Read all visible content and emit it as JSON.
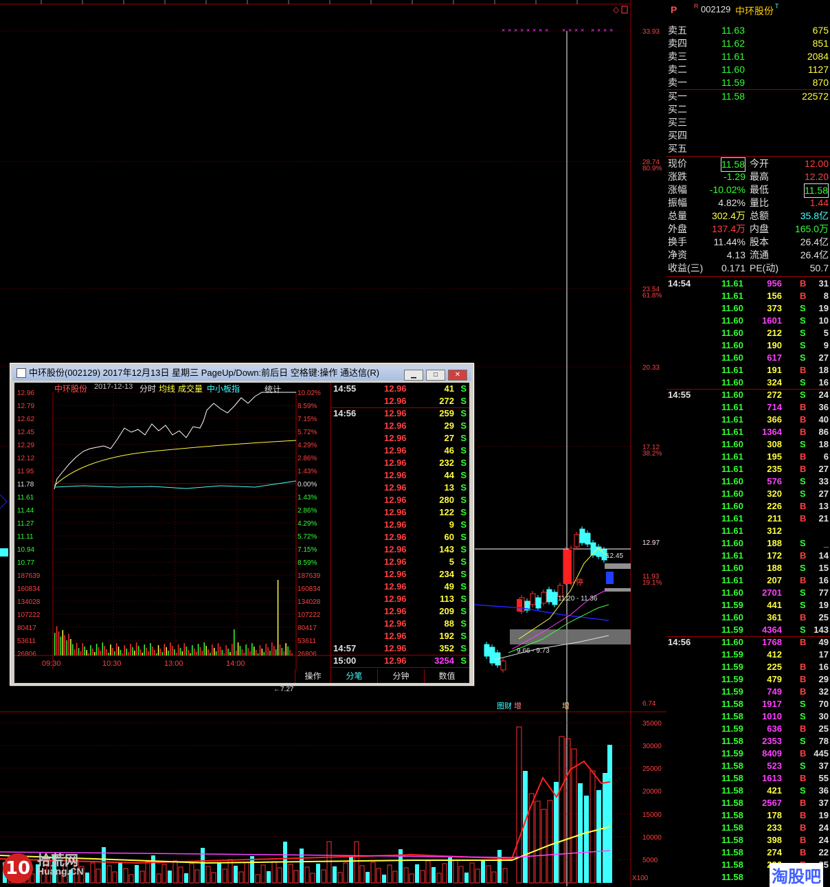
{
  "main_chart": {
    "price_axis": [
      {
        "label": "33.93",
        "pct": ""
      },
      {
        "label": "28.74",
        "pct": "80.9%"
      },
      {
        "label": "23.54",
        "pct": "61.8%"
      },
      {
        "label": "20.33",
        "pct": ""
      },
      {
        "label": "17.12",
        "pct": "38.2%"
      },
      {
        "label": "12.97",
        "pct": ""
      },
      {
        "label": "11.93",
        "pct": "19.1%"
      },
      {
        "label": "6.74",
        "pct": ""
      }
    ],
    "volume_axis": [
      "35000",
      "30000",
      "25000",
      "20000",
      "15000",
      "10000",
      "5000",
      "X100"
    ],
    "annotations": {
      "high_mark": "12.45",
      "mid_range": "11.20 - 11.36",
      "low_range": "9.66 - 9.73",
      "left_arrow": "←7.27",
      "event_tags": [
        "增",
        "增",
        "增"
      ],
      "event_tag_label": "图财",
      "stop_tag": "停"
    },
    "colors": {
      "up": "#ff3030",
      "down": "#40ffff",
      "grid": "#800000"
    }
  },
  "quote_panel": {
    "flag": "P",
    "r_flag": "R",
    "code": "002129",
    "name": "中环股份",
    "t_flag": "T",
    "sells": [
      {
        "label": "卖五",
        "price": "11.63",
        "vol": "675"
      },
      {
        "label": "卖四",
        "price": "11.62",
        "vol": "851"
      },
      {
        "label": "卖三",
        "price": "11.61",
        "vol": "2084"
      },
      {
        "label": "卖二",
        "price": "11.60",
        "vol": "1127"
      },
      {
        "label": "卖一",
        "price": "11.59",
        "vol": "870"
      }
    ],
    "buys": [
      {
        "label": "买一",
        "price": "11.58",
        "vol": "22572"
      },
      {
        "label": "买二",
        "price": "",
        "vol": ""
      },
      {
        "label": "买三",
        "price": "",
        "vol": ""
      },
      {
        "label": "买四",
        "price": "",
        "vol": ""
      },
      {
        "label": "买五",
        "price": "",
        "vol": ""
      }
    ],
    "stats": [
      {
        "l1": "现价",
        "v1": "11.58",
        "l2": "今开",
        "v2": "12.00"
      },
      {
        "l1": "涨跌",
        "v1": "-1.29",
        "l2": "最高",
        "v2": "12.20"
      },
      {
        "l1": "涨幅",
        "v1": "-10.02%",
        "l2": "最低",
        "v2": "11.58"
      },
      {
        "l1": "振幅",
        "v1": "4.82%",
        "l2": "量比",
        "v2": "1.44"
      },
      {
        "l1": "总量",
        "v1": "302.4万",
        "l2": "总额",
        "v2": "35.8亿"
      },
      {
        "l1": "外盘",
        "v1": "137.4万",
        "l2": "内盘",
        "v2": "165.0万"
      },
      {
        "l1": "换手",
        "v1": "11.44%",
        "l2": "股本",
        "v2": "26.4亿"
      },
      {
        "l1": "净资",
        "v1": "4.13",
        "l2": "流通",
        "v2": "26.4亿"
      },
      {
        "l1": "收益(三)",
        "v1": "0.171",
        "l2": "PE(动)",
        "v2": "50.7"
      }
    ],
    "trades": [
      {
        "t": "14:54",
        "p": "11.61",
        "v": "956",
        "s": "B",
        "n": "31"
      },
      {
        "t": "",
        "p": "11.61",
        "v": "156",
        "s": "B",
        "n": "8"
      },
      {
        "t": "",
        "p": "11.60",
        "v": "373",
        "s": "S",
        "n": "19"
      },
      {
        "t": "",
        "p": "11.60",
        "v": "1601",
        "s": "S",
        "n": "10"
      },
      {
        "t": "",
        "p": "11.60",
        "v": "212",
        "s": "S",
        "n": "5"
      },
      {
        "t": "",
        "p": "11.60",
        "v": "190",
        "s": "S",
        "n": "9"
      },
      {
        "t": "",
        "p": "11.60",
        "v": "617",
        "s": "S",
        "n": "27"
      },
      {
        "t": "",
        "p": "11.61",
        "v": "191",
        "s": "B",
        "n": "18"
      },
      {
        "t": "",
        "p": "11.60",
        "v": "324",
        "s": "S",
        "n": "16"
      },
      {
        "t": "14:55",
        "p": "11.60",
        "v": "272",
        "s": "S",
        "n": "24"
      },
      {
        "t": "",
        "p": "11.61",
        "v": "714",
        "s": "B",
        "n": "36"
      },
      {
        "t": "",
        "p": "11.61",
        "v": "366",
        "s": "B",
        "n": "40"
      },
      {
        "t": "",
        "p": "11.61",
        "v": "1364",
        "s": "B",
        "n": "86"
      },
      {
        "t": "",
        "p": "11.60",
        "v": "308",
        "s": "S",
        "n": "18"
      },
      {
        "t": "",
        "p": "11.61",
        "v": "195",
        "s": "B",
        "n": "6"
      },
      {
        "t": "",
        "p": "11.61",
        "v": "235",
        "s": "B",
        "n": "27"
      },
      {
        "t": "",
        "p": "11.60",
        "v": "576",
        "s": "S",
        "n": "33"
      },
      {
        "t": "",
        "p": "11.60",
        "v": "320",
        "s": "S",
        "n": "27"
      },
      {
        "t": "",
        "p": "11.60",
        "v": "226",
        "s": "B",
        "n": "13"
      },
      {
        "t": "",
        "p": "11.61",
        "v": "211",
        "s": "B",
        "n": "21"
      },
      {
        "t": "",
        "p": "11.61",
        "v": "312",
        "s": "",
        "n": ""
      },
      {
        "t": "",
        "p": "11.60",
        "v": "188",
        "s": "S",
        "n": "_"
      },
      {
        "t": "",
        "p": "11.61",
        "v": "172",
        "s": "B",
        "n": "14"
      },
      {
        "t": "",
        "p": "11.60",
        "v": "188",
        "s": "S",
        "n": "15"
      },
      {
        "t": "",
        "p": "11.61",
        "v": "207",
        "s": "B",
        "n": "16"
      },
      {
        "t": "",
        "p": "11.60",
        "v": "2701",
        "s": "S",
        "n": "77"
      },
      {
        "t": "",
        "p": "11.59",
        "v": "441",
        "s": "S",
        "n": "19"
      },
      {
        "t": "",
        "p": "11.60",
        "v": "361",
        "s": "B",
        "n": "25"
      },
      {
        "t": "",
        "p": "11.59",
        "v": "4364",
        "s": "S",
        "n": "143"
      },
      {
        "t": "14:56",
        "p": "11.60",
        "v": "1768",
        "s": "B",
        "n": "49"
      },
      {
        "t": "",
        "p": "11.59",
        "v": "412",
        "s": "",
        "n": "17"
      },
      {
        "t": "",
        "p": "11.59",
        "v": "225",
        "s": "B",
        "n": "16"
      },
      {
        "t": "",
        "p": "11.59",
        "v": "479",
        "s": "B",
        "n": "29"
      },
      {
        "t": "",
        "p": "11.59",
        "v": "749",
        "s": "B",
        "n": "32"
      },
      {
        "t": "",
        "p": "11.58",
        "v": "1917",
        "s": "S",
        "n": "70"
      },
      {
        "t": "",
        "p": "11.58",
        "v": "1010",
        "s": "S",
        "n": "30"
      },
      {
        "t": "",
        "p": "11.59",
        "v": "636",
        "s": "B",
        "n": "25"
      },
      {
        "t": "",
        "p": "11.58",
        "v": "2353",
        "s": "S",
        "n": "78"
      },
      {
        "t": "",
        "p": "11.59",
        "v": "8409",
        "s": "B",
        "n": "445"
      },
      {
        "t": "",
        "p": "11.58",
        "v": "523",
        "s": "S",
        "n": "37"
      },
      {
        "t": "",
        "p": "11.58",
        "v": "1613",
        "s": "B",
        "n": "55"
      },
      {
        "t": "",
        "p": "11.58",
        "v": "421",
        "s": "S",
        "n": "36"
      },
      {
        "t": "",
        "p": "11.58",
        "v": "2567",
        "s": "B",
        "n": "37"
      },
      {
        "t": "",
        "p": "11.58",
        "v": "178",
        "s": "B",
        "n": "19"
      },
      {
        "t": "",
        "p": "11.58",
        "v": "233",
        "s": "B",
        "n": "24"
      },
      {
        "t": "",
        "p": "11.58",
        "v": "398",
        "s": "B",
        "n": "24"
      },
      {
        "t": "",
        "p": "11.58",
        "v": "274",
        "s": "B",
        "n": "22"
      },
      {
        "t": "",
        "p": "11.58",
        "v": "296",
        "s": "B",
        "n": "25"
      },
      {
        "t": "",
        "p": "11.58",
        "v": "",
        "s": "",
        "n": ""
      }
    ]
  },
  "popup": {
    "title": "中环股份(002129) 2017年12月13日 星期三 PageUp/Down:前后日 空格键:操作 通达信(R)",
    "chart_header": {
      "name": "中环股份",
      "date": "2017-12-13",
      "mode": "分时",
      "avg": "均线",
      "vol": "成交量",
      "index": "中小板指",
      "stat": "统计"
    },
    "price_ticks": [
      "12.96",
      "12.79",
      "12.62",
      "12.45",
      "12.29",
      "12.12",
      "11.95",
      "11.78",
      "11.61",
      "11.44",
      "11.27",
      "11.11",
      "10.94",
      "10.77"
    ],
    "pct_ticks": [
      "10.02%",
      "8.59%",
      "7.15%",
      "5.72%",
      "4.29%",
      "2.86%",
      "1.43%",
      "0.00%",
      "1.43%",
      "2.86%",
      "4.29%",
      "5.72%",
      "7.15%",
      "8.59%"
    ],
    "vol_ticks": [
      "187639",
      "160834",
      "134028",
      "107222",
      "80417",
      "53611",
      "26806"
    ],
    "time_ticks": [
      "09:30",
      "10:30",
      "13:00",
      "14:00"
    ],
    "trades": [
      {
        "t": "14:55",
        "p": "12.96",
        "v": "41",
        "s": "S"
      },
      {
        "t": "",
        "p": "12.96",
        "v": "272",
        "s": "S"
      },
      {
        "t": "14:56",
        "p": "12.96",
        "v": "259",
        "s": "S"
      },
      {
        "t": "",
        "p": "12.96",
        "v": "29",
        "s": "S"
      },
      {
        "t": "",
        "p": "12.96",
        "v": "27",
        "s": "S"
      },
      {
        "t": "",
        "p": "12.96",
        "v": "46",
        "s": "S"
      },
      {
        "t": "",
        "p": "12.96",
        "v": "232",
        "s": "S"
      },
      {
        "t": "",
        "p": "12.96",
        "v": "44",
        "s": "S"
      },
      {
        "t": "",
        "p": "12.96",
        "v": "13",
        "s": "S"
      },
      {
        "t": "",
        "p": "12.96",
        "v": "280",
        "s": "S"
      },
      {
        "t": "",
        "p": "12.96",
        "v": "122",
        "s": "S"
      },
      {
        "t": "",
        "p": "12.96",
        "v": "9",
        "s": "S"
      },
      {
        "t": "",
        "p": "12.96",
        "v": "60",
        "s": "S"
      },
      {
        "t": "",
        "p": "12.96",
        "v": "143",
        "s": "S"
      },
      {
        "t": "",
        "p": "12.96",
        "v": "5",
        "s": "S"
      },
      {
        "t": "",
        "p": "12.96",
        "v": "234",
        "s": "S"
      },
      {
        "t": "",
        "p": "12.96",
        "v": "49",
        "s": "S"
      },
      {
        "t": "",
        "p": "12.96",
        "v": "113",
        "s": "S"
      },
      {
        "t": "",
        "p": "12.96",
        "v": "209",
        "s": "S"
      },
      {
        "t": "",
        "p": "12.96",
        "v": "88",
        "s": "S"
      },
      {
        "t": "",
        "p": "12.96",
        "v": "192",
        "s": "S"
      },
      {
        "t": "14:57",
        "p": "12.96",
        "v": "352",
        "s": "S"
      },
      {
        "t": "15:00",
        "p": "12.96",
        "v": "3254",
        "s": "S"
      }
    ],
    "tabs": [
      "操作",
      "分笔",
      "分钟",
      "数值"
    ]
  },
  "watermarks": {
    "left": "拾荒网",
    "left_sub": "Huang.CN",
    "right": "淘股吧"
  }
}
